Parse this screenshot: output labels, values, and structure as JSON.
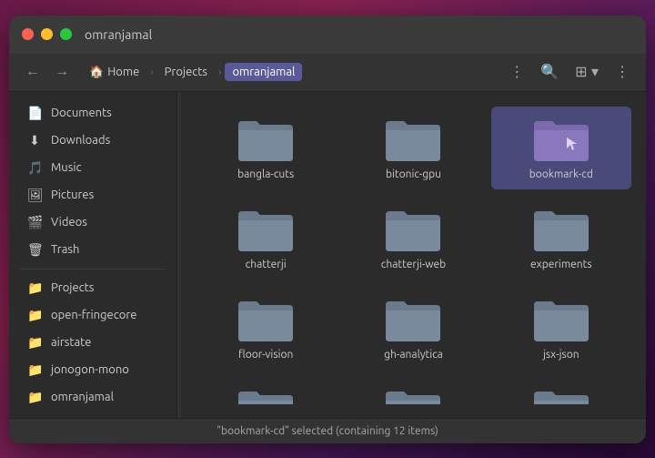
{
  "window": {
    "title": "omranjamal",
    "controls": {
      "close_label": "",
      "min_label": "",
      "max_label": ""
    }
  },
  "toolbar": {
    "back_icon": "←",
    "forward_icon": "→",
    "breadcrumbs": [
      {
        "label": "Home",
        "icon": "🏠",
        "active": false
      },
      {
        "label": "Projects",
        "active": false
      },
      {
        "label": "omranjamal",
        "active": true
      }
    ],
    "menu_icon": "⋮",
    "search_icon": "🔍",
    "view_icon": "⊞",
    "dropdown_icon": "▾",
    "more_icon": "⋮"
  },
  "sidebar": {
    "items": [
      {
        "id": "documents",
        "label": "Documents",
        "icon": "📄"
      },
      {
        "id": "downloads",
        "label": "Downloads",
        "icon": "⬇"
      },
      {
        "id": "music",
        "label": "Music",
        "icon": "🎵"
      },
      {
        "id": "pictures",
        "label": "Pictures",
        "icon": "🖼"
      },
      {
        "id": "videos",
        "label": "Videos",
        "icon": "🎬"
      },
      {
        "id": "trash",
        "label": "Trash",
        "icon": "🗑"
      },
      {
        "id": "projects",
        "label": "Projects",
        "icon": "📁"
      },
      {
        "id": "open-fringecore",
        "label": "open-fringecore",
        "icon": "📁"
      },
      {
        "id": "airstate",
        "label": "airstate",
        "icon": "📁"
      },
      {
        "id": "jonogon-mono",
        "label": "jonogon-mono",
        "icon": "📁"
      },
      {
        "id": "omranjamal",
        "label": "omranjamal",
        "icon": "📁"
      }
    ]
  },
  "files": {
    "items": [
      {
        "id": "bangla-cuts",
        "label": "bangla-cuts",
        "selected": false
      },
      {
        "id": "bitonic-gpu",
        "label": "bitonic-gpu",
        "selected": false
      },
      {
        "id": "bookmark-cd",
        "label": "bookmark-cd",
        "selected": true
      },
      {
        "id": "chatterji",
        "label": "chatterji",
        "selected": false
      },
      {
        "id": "chatterji-web",
        "label": "chatterji-web",
        "selected": false
      },
      {
        "id": "experiments",
        "label": "experiments",
        "selected": false
      },
      {
        "id": "floor-vision",
        "label": "floor-vision",
        "selected": false
      },
      {
        "id": "gh-analytica",
        "label": "gh-analytica",
        "selected": false
      },
      {
        "id": "jsx-json",
        "label": "jsx-json",
        "selected": false
      },
      {
        "id": "partial1",
        "label": "",
        "selected": false
      },
      {
        "id": "partial2",
        "label": "",
        "selected": false
      },
      {
        "id": "partial3",
        "label": "",
        "selected": false
      }
    ]
  },
  "statusbar": {
    "text": "\"bookmark-cd\" selected (containing 12 items)"
  },
  "colors": {
    "folder_normal": "#6b7a8d",
    "folder_selected": "#7b6aad",
    "selected_bg": "#4a4a7a"
  }
}
